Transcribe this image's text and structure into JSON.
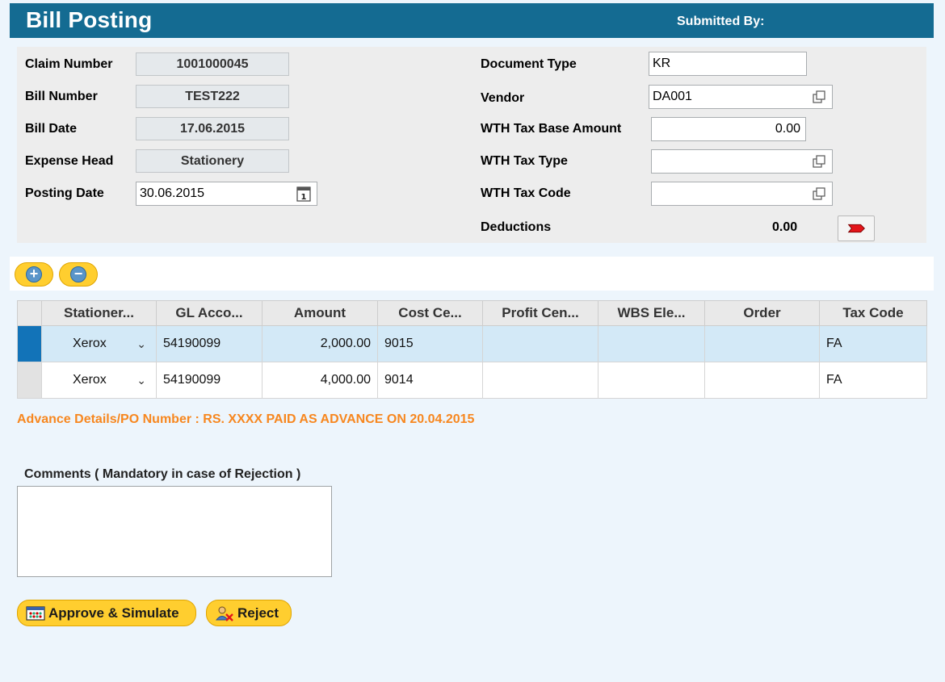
{
  "header": {
    "title": "Bill Posting",
    "submitted_by_label": "Submitted By:"
  },
  "left_fields": {
    "claim_number": {
      "label": "Claim Number",
      "value": "1001000045"
    },
    "bill_number": {
      "label": "Bill Number",
      "value": "TEST222"
    },
    "bill_date": {
      "label": "Bill Date",
      "value": "17.06.2015"
    },
    "expense_head": {
      "label": "Expense Head",
      "value": "Stationery"
    },
    "posting_date": {
      "label": "Posting Date",
      "value": "30.06.2015"
    }
  },
  "right_fields": {
    "document_type": {
      "label": "Document Type",
      "value": "KR"
    },
    "vendor": {
      "label": "Vendor",
      "value": "DA001"
    },
    "wth_base_amount": {
      "label": "WTH Tax Base Amount",
      "value": "0.00"
    },
    "wth_tax_type": {
      "label": "WTH Tax Type",
      "value": ""
    },
    "wth_tax_code": {
      "label": "WTH Tax Code",
      "value": ""
    },
    "deductions": {
      "label": "Deductions",
      "value": "0.00"
    }
  },
  "table": {
    "columns": [
      "Stationer...",
      "GL Acco...",
      "Amount",
      "Cost Ce...",
      "Profit Cen...",
      "WBS Ele...",
      "Order",
      "Tax Code"
    ],
    "rows": [
      {
        "stationery": "Xerox",
        "gl_account": "54190099",
        "amount": "2,000.00",
        "cost_center": "9015",
        "profit_center": "",
        "wbs_element": "",
        "order": "",
        "tax_code": "FA"
      },
      {
        "stationery": "Xerox",
        "gl_account": "54190099",
        "amount": "4,000.00",
        "cost_center": "9014",
        "profit_center": "",
        "wbs_element": "",
        "order": "",
        "tax_code": "FA"
      }
    ]
  },
  "advance": {
    "text": "Advance Details/PO Number : RS. XXXX PAID AS ADVANCE ON 20.04.2015"
  },
  "comments": {
    "label": "Comments ( Mandatory in case of Rejection )",
    "value": ""
  },
  "actions": {
    "approve_label": "Approve & Simulate",
    "reject_label": "Reject"
  },
  "colors": {
    "header_bg": "#146b92",
    "button_yellow": "#ffce2f",
    "selected_row": "#d3e9f7",
    "advance_orange": "#f7871f"
  }
}
